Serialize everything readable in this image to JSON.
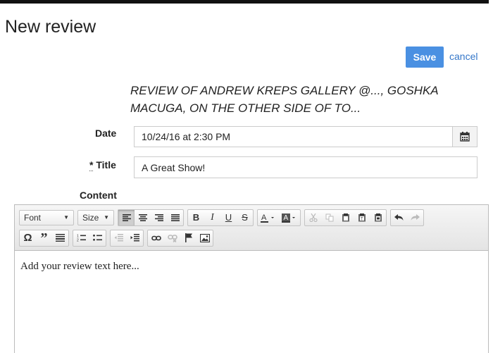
{
  "page": {
    "title": "New review"
  },
  "actions": {
    "save_label": "Save",
    "cancel_label": "cancel"
  },
  "review": {
    "heading": "REVIEW OF ANDREW KREPS GALLERY @..., GOSHKA MACUGA, ON THE OTHER SIDE OF TO..."
  },
  "form": {
    "date_label": "Date",
    "date_value": "10/24/16 at 2:30 PM",
    "title_required_mark": "*",
    "title_label": "Title",
    "title_value": "A Great Show!",
    "content_label": "Content"
  },
  "editor": {
    "font_combo": "Font",
    "size_combo": "Size",
    "quote_glyph": "”",
    "body_text": "Add your review text here..."
  },
  "colors": {
    "accent": "#4a90e2",
    "link": "#3577c9"
  }
}
